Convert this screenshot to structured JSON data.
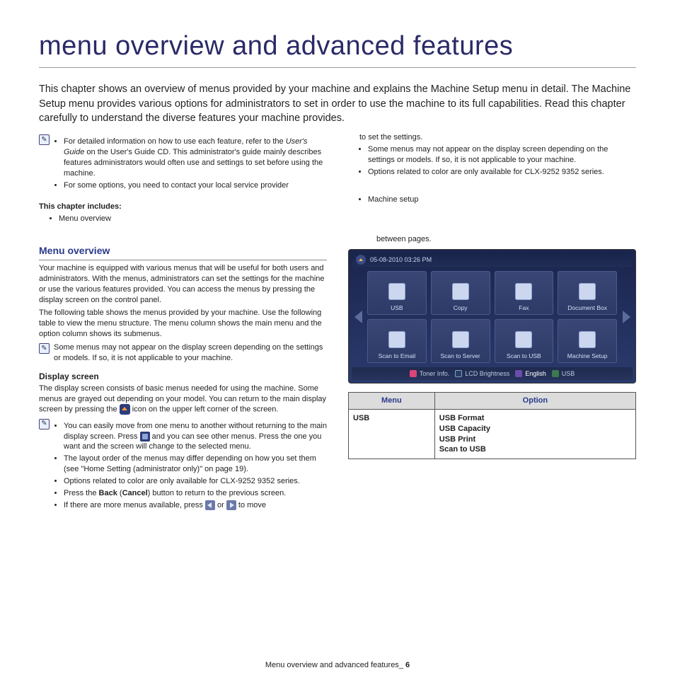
{
  "page": {
    "title": "menu overview and advanced features",
    "intro": "This chapter shows an overview of menus provided by your machine and explains the Machine Setup menu in detail. The Machine Setup menu provides various options for administrators to set in order to use the machine to its full capabilities. Read this chapter carefully to understand the diverse features your machine provides.",
    "footer_label": "Menu overview and advanced features_",
    "footer_page": "6"
  },
  "top_notes_left": {
    "b1a": "For detailed information on how to use each feature, refer to the ",
    "b1b": "User's Guide",
    "b1c": " on the User's Guide CD. This administrator's guide mainly describes features administrators would often use and settings to set before using the machine.",
    "b2": "For some options, you need to contact your local service provider"
  },
  "top_notes_right": {
    "cont": "to set the settings.",
    "b1": "Some menus may not appear on the display screen depending on the settings or models. If so, it is not applicable to your machine.",
    "b2": "Options related to color are only available for CLX-9252 9352 series."
  },
  "includes": {
    "heading": "This chapter includes:",
    "left": "Menu overview",
    "right": "Machine setup"
  },
  "menu_overview": {
    "heading": "Menu overview",
    "p1": "Your machine is equipped with various menus that will be useful for both users and administrators. With the menus, administrators can set the settings for the machine or use the various features provided. You can access the menus by pressing the display screen on the control panel.",
    "p2": "The following table shows the menus provided by your machine. Use the following table to view the menu structure. The menu column shows the main menu and the option column shows its submenus.",
    "note": "Some menus may not appear on the display screen depending on the settings or models. If so, it is not applicable to your machine."
  },
  "display_screen": {
    "heading": "Display screen",
    "p1a": "The display screen consists of basic menus needed for using the machine. Some menus are grayed out depending on your model. You can return to the main display screen by pressing the ",
    "p1b": " icon on the upper left corner of the screen.",
    "bullets": {
      "b1a": "You can easily move from one menu to another without returning to the main display screen. Press ",
      "b1b": " and you can see other menus. Press the one you want and the screen will change to the selected menu.",
      "b2": "The layout order of the menus may differ depending on how you set them (see \"Home Setting (administrator only)\" on page 19).",
      "b3": "Options related to color are only available for CLX-9252 9352 series.",
      "b4a": "Press the ",
      "b4b": "Back",
      "b4c": " (",
      "b4d": "Cancel",
      "b4e": ") button to return to the previous screen.",
      "b5a": "If there are more menus available, press ",
      "b5b": " or ",
      "b5c": " to move"
    }
  },
  "right_col": {
    "between": "between pages."
  },
  "device": {
    "timestamp": "05-08-2010 03:26 PM",
    "tiles": [
      "USB",
      "Copy",
      "Fax",
      "Document Box",
      "Scan to Email",
      "Scan to Server",
      "Scan to USB",
      "Machine Setup"
    ],
    "statusbar": {
      "toner": "Toner Info.",
      "lcd": "LCD Brightness",
      "lang": "English",
      "usb": "USB"
    }
  },
  "table": {
    "head_menu": "Menu",
    "head_option": "Option",
    "row1_menu": "USB",
    "row1_opts": [
      "USB Format",
      "USB Capacity",
      "USB Print",
      "Scan to USB"
    ]
  }
}
